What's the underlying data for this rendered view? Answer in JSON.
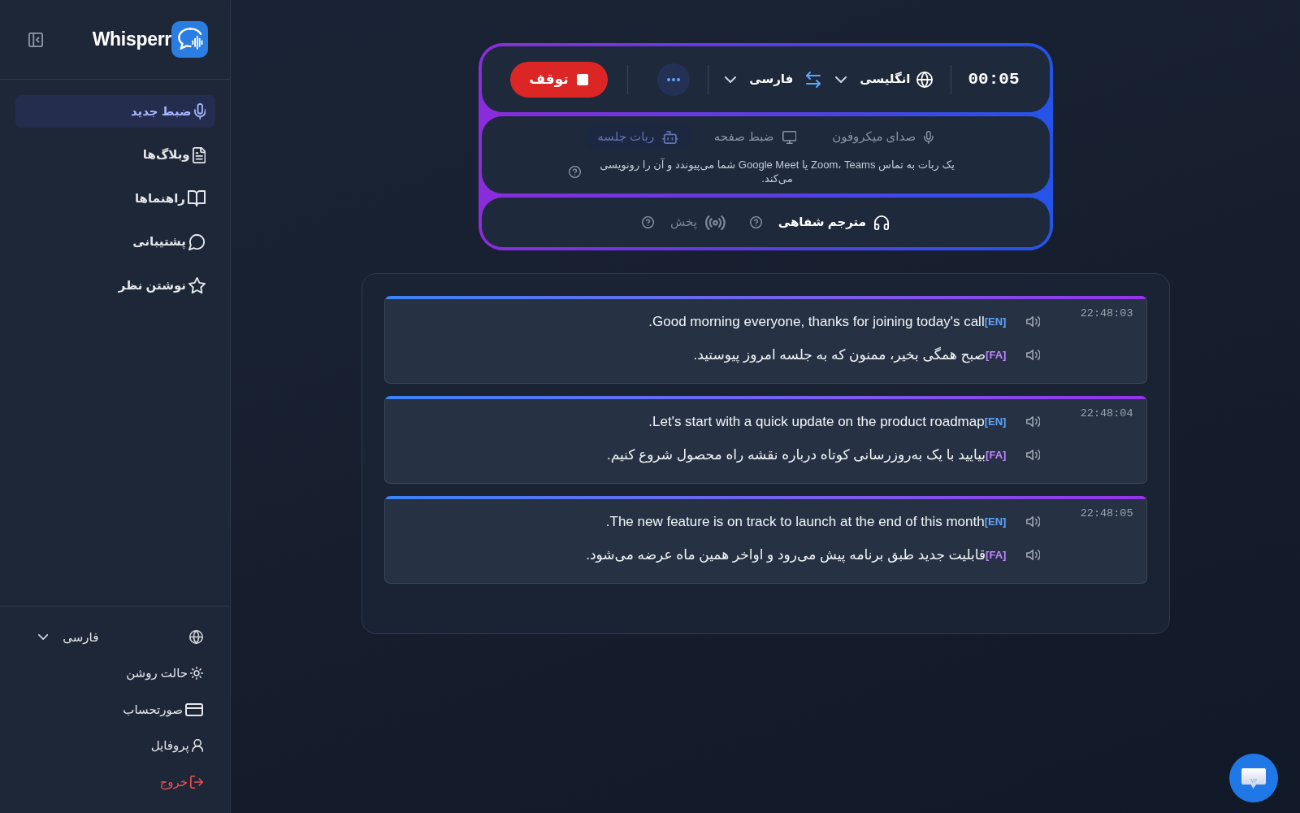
{
  "sidebar": {
    "brand": "Whisperr",
    "nav_items": [
      {
        "label": "ضبط جدید",
        "selected": true
      },
      {
        "label": "وبلاگ‌ها",
        "selected": false
      },
      {
        "label": "راهنماها",
        "selected": false
      },
      {
        "label": "پشتیبانی",
        "selected": false
      },
      {
        "label": "نوشتن نظر",
        "selected": false
      }
    ],
    "language_select": {
      "value": "فارسی"
    },
    "footer_items": [
      {
        "label": "حالت روشن",
        "kind": "link"
      },
      {
        "label": "صورتحساب",
        "kind": "link"
      },
      {
        "label": "پروفایل",
        "kind": "link"
      },
      {
        "label": "خروج",
        "kind": "danger"
      }
    ]
  },
  "recorder": {
    "timer": "00:05",
    "source_language": "انگلیسی",
    "target_language": "فارسی",
    "stop_button": "توقف",
    "sources": [
      {
        "label": "صدای میکروفون",
        "selected": false
      },
      {
        "label": "ضبط صفحه",
        "selected": false
      },
      {
        "label": "ربات جلسه",
        "selected": true
      }
    ],
    "source_description": "یک ربات به تماس Zoom، Teams یا Google Meet شما می‌پیوندد و آن را رونویسی می‌کند.",
    "modes": [
      {
        "label": "مترجم شفاهی",
        "selected": true
      },
      {
        "label": "پخش",
        "selected": false
      }
    ]
  },
  "transcript": {
    "entries": [
      {
        "time": "22:48:03",
        "lines": [
          {
            "kind": "source",
            "tag": "[EN]",
            "text": "Good morning everyone, thanks for joining today's call."
          },
          {
            "kind": "translation",
            "tag": "[FA]",
            "text": "صبح همگی بخیر، ممنون که به جلسه امروز پیوستید."
          }
        ]
      },
      {
        "time": "22:48:04",
        "lines": [
          {
            "kind": "source",
            "tag": "[EN]",
            "text": "Let's start with a quick update on the product roadmap."
          },
          {
            "kind": "translation",
            "tag": "[FA]",
            "text": "بیایید با یک به‌روزرسانی کوتاه درباره نقشه راه محصول شروع کنیم."
          }
        ]
      },
      {
        "time": "22:48:05",
        "lines": [
          {
            "kind": "source",
            "tag": "[EN]",
            "text": "The new feature is on track to launch at the end of this month."
          },
          {
            "kind": "translation",
            "tag": "[FA]",
            "text": "قابلیت جدید طبق برنامه پیش می‌رود و اواخر همین ماه عرضه می‌شود."
          }
        ]
      }
    ]
  }
}
